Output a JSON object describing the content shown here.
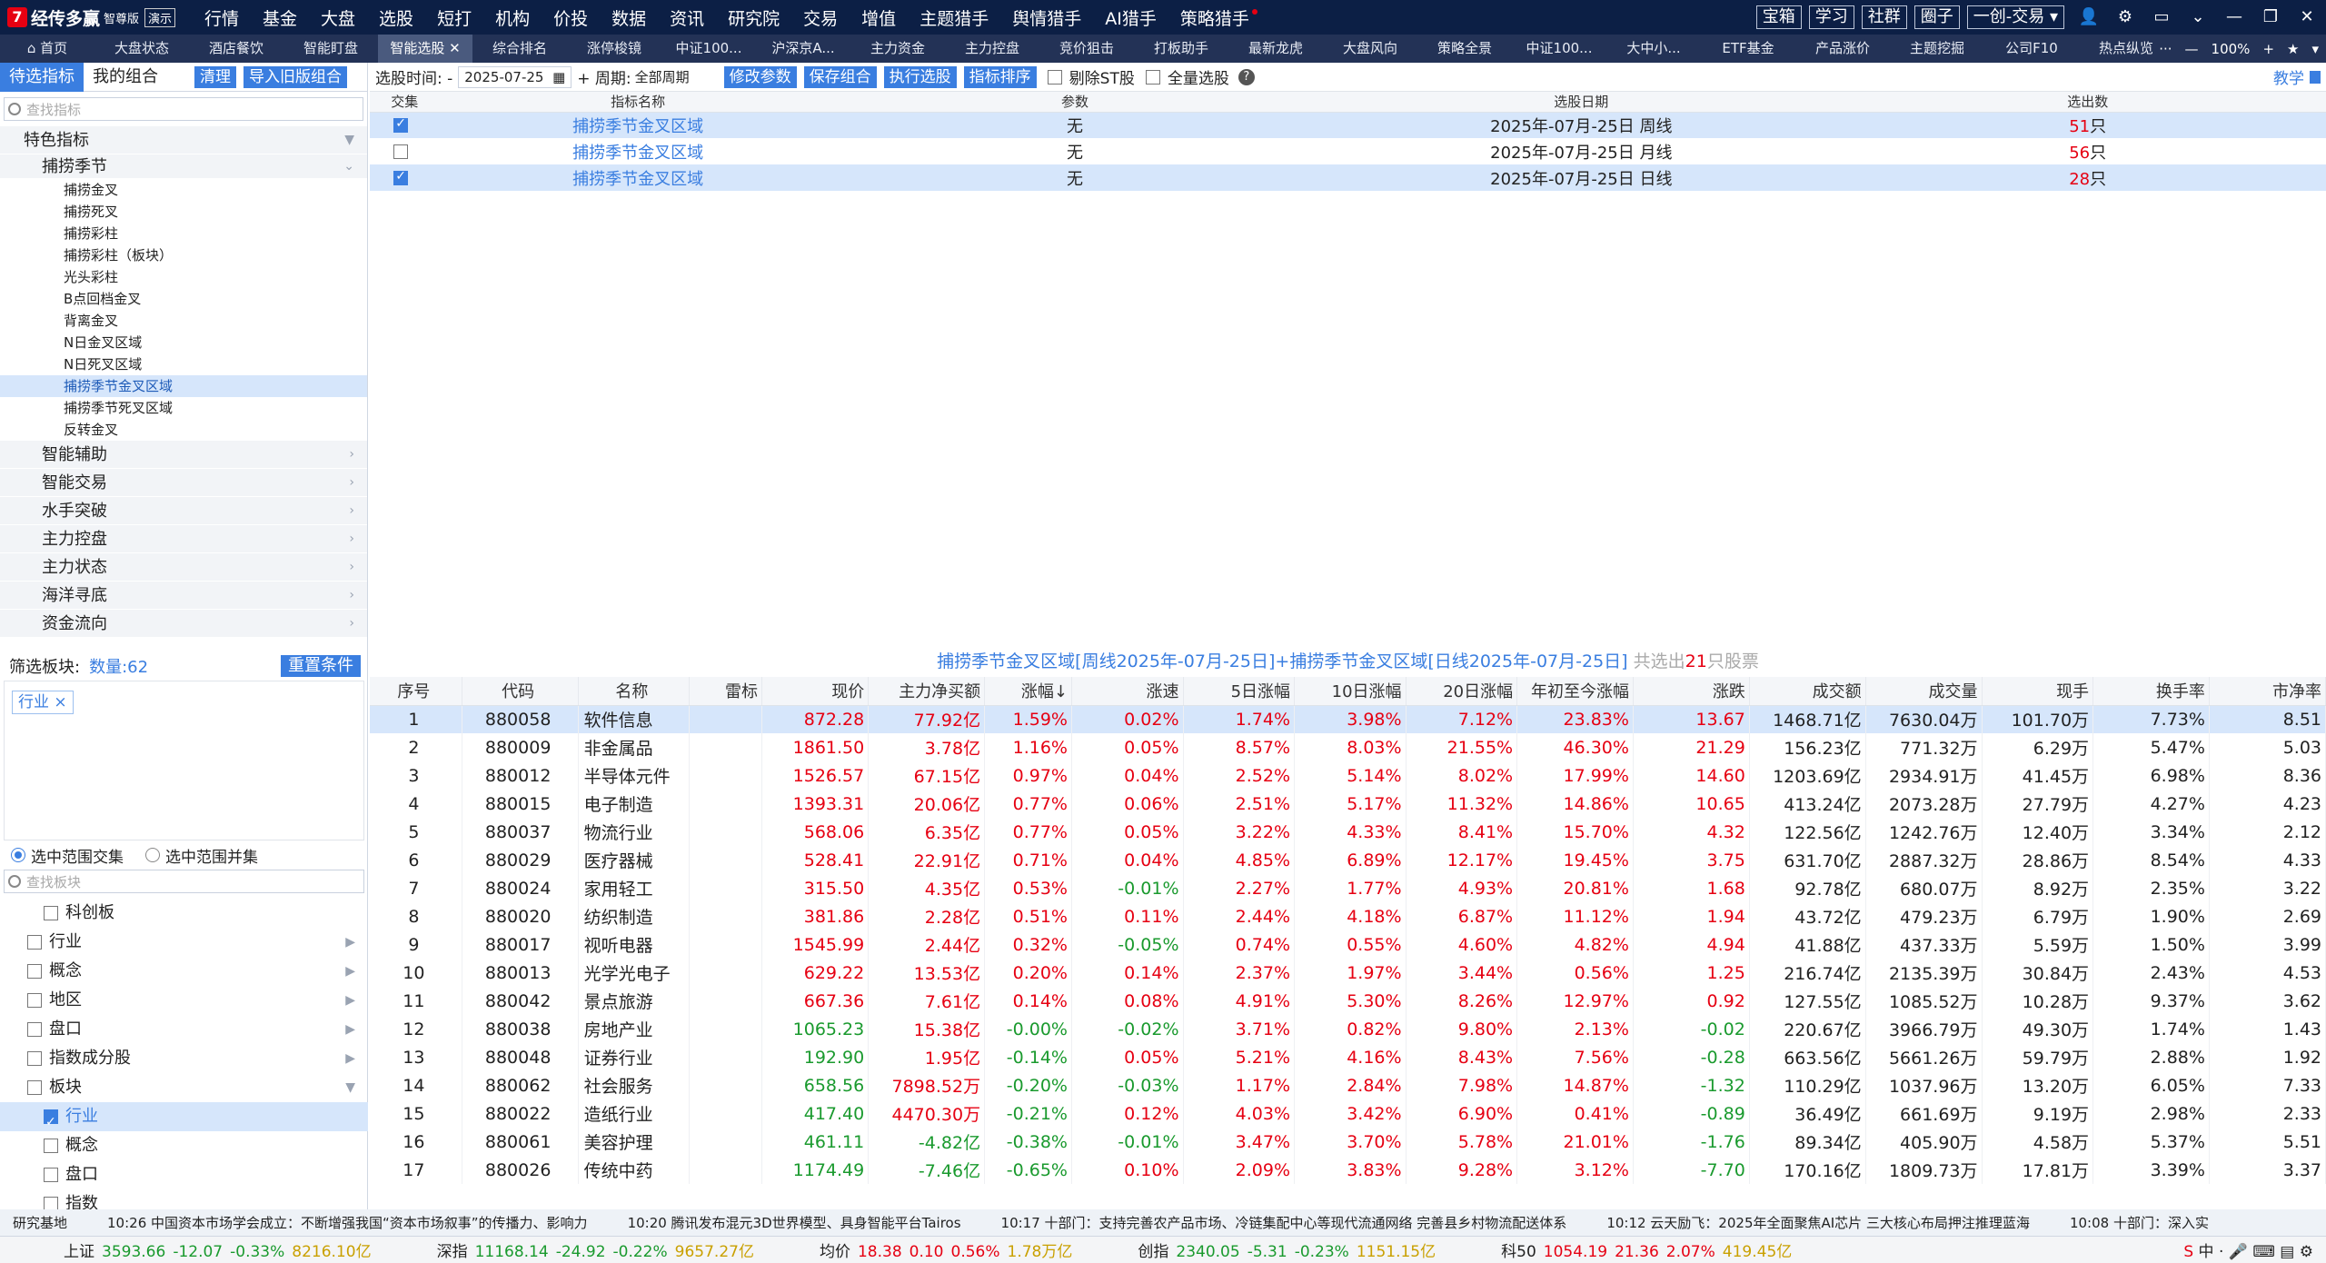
{
  "app": {
    "name": "经传多赢",
    "edition": "智尊版",
    "mode": "演示"
  },
  "menu": [
    "行情",
    "基金",
    "大盘",
    "选股",
    "短打",
    "机构",
    "价投",
    "数据",
    "资讯",
    "研究院",
    "交易",
    "增值",
    "主题猎手",
    "舆情猎手",
    "AI猎手",
    "策略猎手"
  ],
  "top_buttons": [
    "宝箱",
    "学习",
    "社群",
    "圈子",
    "一创-交易"
  ],
  "tabs": [
    "首页",
    "大盘状态",
    "酒店餐饮",
    "智能盯盘",
    "智能选股",
    "综合排名",
    "涨停梭镜",
    "中证100...",
    "沪深京A...",
    "主力资金",
    "主力控盘",
    "竞价狙击",
    "打板助手",
    "最新龙虎",
    "大盘风向",
    "策略全景",
    "中证100...",
    "大中小...",
    "ETF基金",
    "产品涨价",
    "主题挖掘",
    "公司F10",
    "热点纵览"
  ],
  "active_tab": "智能选股",
  "zoom": "100%",
  "left": {
    "tabs": [
      "待选指标",
      "我的组合"
    ],
    "buttons": [
      "清理",
      "导入旧版组合"
    ],
    "search_placeholder": "查找指标",
    "root": "特色指标",
    "group": "捕捞季节",
    "leaves": [
      "捕捞金叉",
      "捕捞死叉",
      "捕捞彩柱",
      "捕捞彩柱（板块）",
      "光头彩柱",
      "B点回档金叉",
      "背离金叉",
      "N日金叉区域",
      "N日死叉区域",
      "捕捞季节金叉区域",
      "捕捞季节死叉区域",
      "反转金叉"
    ],
    "selected_leaf": "捕捞季节金叉区域",
    "groups": [
      "智能辅助",
      "智能交易",
      "水手突破",
      "主力控盘",
      "主力状态",
      "海洋寻底",
      "资金流向"
    ],
    "filter_label": "筛选板块:",
    "count_label": "数量:62",
    "reset": "重置条件",
    "tag": "行业",
    "radio": [
      "选中范围交集",
      "选中范围并集"
    ],
    "search_board": "查找板块",
    "board_items": [
      {
        "label": "科创板",
        "indent": true,
        "checked": false,
        "arrow": ""
      },
      {
        "label": "行业",
        "indent": false,
        "checked": false,
        "arrow": "▶"
      },
      {
        "label": "概念",
        "indent": false,
        "checked": false,
        "arrow": "▶"
      },
      {
        "label": "地区",
        "indent": false,
        "checked": false,
        "arrow": "▶"
      },
      {
        "label": "盘口",
        "indent": false,
        "checked": false,
        "arrow": "▶"
      },
      {
        "label": "指数成分股",
        "indent": false,
        "checked": false,
        "arrow": "▶"
      },
      {
        "label": "板块",
        "indent": false,
        "checked": false,
        "arrow": "▼"
      },
      {
        "label": "行业",
        "indent": true,
        "checked": true,
        "arrow": ""
      },
      {
        "label": "概念",
        "indent": true,
        "checked": false,
        "arrow": ""
      },
      {
        "label": "盘口",
        "indent": true,
        "checked": false,
        "arrow": ""
      },
      {
        "label": "指数",
        "indent": true,
        "checked": false,
        "arrow": ""
      }
    ]
  },
  "toolbar": {
    "date_label": "选股时间: -",
    "date": "2025-07-25",
    "period_label": "+ 周期:",
    "period": "全部周期",
    "buttons": [
      "修改参数",
      "保存组合",
      "执行选股",
      "指标排序"
    ],
    "checks": [
      "剔除ST股",
      "全量选股"
    ],
    "help": "教学"
  },
  "top_table": {
    "headers": [
      "交集",
      "指标名称",
      "参数",
      "选股日期",
      "选出数"
    ],
    "rows": [
      {
        "checked": true,
        "name": "捕捞季节金叉区域",
        "param": "无",
        "date": "2025年-07月-25日 周线",
        "num": "51",
        "unit": "只"
      },
      {
        "checked": false,
        "name": "捕捞季节金叉区域",
        "param": "无",
        "date": "2025年-07月-25日 月线",
        "num": "56",
        "unit": "只"
      },
      {
        "checked": true,
        "name": "捕捞季节金叉区域",
        "param": "无",
        "date": "2025年-07月-25日 日线",
        "num": "28",
        "unit": "只"
      }
    ]
  },
  "result_title": {
    "text": "捕捞季节金叉区域[周线2025年-07月-25日]+捕捞季节金叉区域[日线2025年-07月-25日]",
    "prefix": "共选出",
    "count": "21",
    "suffix": "只股票"
  },
  "bottom_table": {
    "headers": [
      "序号",
      "代码",
      "名称",
      "雷标",
      "现价",
      "主力净买额",
      "涨幅↓",
      "涨速",
      "5日涨幅",
      "10日涨幅",
      "20日涨幅",
      "年初至今涨幅",
      "涨跌",
      "成交额",
      "成交量",
      "现手",
      "换手率",
      "市净率"
    ],
    "rows": [
      [
        "1",
        "880058",
        "软件信息",
        "",
        "872.28",
        "77.92亿",
        "1.59%",
        "0.02%",
        "1.74%",
        "3.98%",
        "7.12%",
        "23.83%",
        "13.67",
        "1468.71亿",
        "7630.04万",
        "101.70万",
        "7.73%",
        "8.51"
      ],
      [
        "2",
        "880009",
        "非金属品",
        "",
        "1861.50",
        "3.78亿",
        "1.16%",
        "0.05%",
        "8.57%",
        "8.03%",
        "21.55%",
        "46.30%",
        "21.29",
        "156.23亿",
        "771.32万",
        "6.29万",
        "5.47%",
        "5.03"
      ],
      [
        "3",
        "880012",
        "半导体元件",
        "",
        "1526.57",
        "67.15亿",
        "0.97%",
        "0.04%",
        "2.52%",
        "5.14%",
        "8.02%",
        "17.99%",
        "14.60",
        "1203.69亿",
        "2934.91万",
        "41.45万",
        "6.98%",
        "8.36"
      ],
      [
        "4",
        "880015",
        "电子制造",
        "",
        "1393.31",
        "20.06亿",
        "0.77%",
        "0.06%",
        "2.51%",
        "5.17%",
        "11.32%",
        "14.86%",
        "10.65",
        "413.24亿",
        "2073.28万",
        "27.79万",
        "4.27%",
        "4.23"
      ],
      [
        "5",
        "880037",
        "物流行业",
        "",
        "568.06",
        "6.35亿",
        "0.77%",
        "0.05%",
        "3.22%",
        "4.33%",
        "8.41%",
        "15.70%",
        "4.32",
        "122.56亿",
        "1242.76万",
        "12.40万",
        "3.34%",
        "2.12"
      ],
      [
        "6",
        "880029",
        "医疗器械",
        "",
        "528.41",
        "22.91亿",
        "0.71%",
        "0.04%",
        "4.85%",
        "6.89%",
        "12.17%",
        "19.45%",
        "3.75",
        "631.70亿",
        "2887.32万",
        "28.86万",
        "8.54%",
        "4.33"
      ],
      [
        "7",
        "880024",
        "家用轻工",
        "",
        "315.50",
        "4.35亿",
        "0.53%",
        "-0.01%",
        "2.27%",
        "1.77%",
        "4.93%",
        "20.81%",
        "1.68",
        "92.78亿",
        "680.07万",
        "8.92万",
        "2.35%",
        "3.22"
      ],
      [
        "8",
        "880020",
        "纺织制造",
        "",
        "381.86",
        "2.28亿",
        "0.51%",
        "0.11%",
        "2.44%",
        "4.18%",
        "6.87%",
        "11.12%",
        "1.94",
        "43.72亿",
        "479.23万",
        "6.79万",
        "1.90%",
        "2.69"
      ],
      [
        "9",
        "880017",
        "视听电器",
        "",
        "1545.99",
        "2.44亿",
        "0.32%",
        "-0.05%",
        "0.74%",
        "0.55%",
        "4.60%",
        "4.82%",
        "4.94",
        "41.88亿",
        "437.33万",
        "5.59万",
        "1.50%",
        "3.99"
      ],
      [
        "10",
        "880013",
        "光学光电子",
        "",
        "629.22",
        "13.53亿",
        "0.20%",
        "0.14%",
        "2.37%",
        "1.97%",
        "3.44%",
        "0.56%",
        "1.25",
        "216.74亿",
        "2135.39万",
        "30.84万",
        "2.43%",
        "4.53"
      ],
      [
        "11",
        "880042",
        "景点旅游",
        "",
        "667.36",
        "7.61亿",
        "0.14%",
        "0.08%",
        "4.91%",
        "5.30%",
        "8.26%",
        "12.97%",
        "0.92",
        "127.55亿",
        "1085.52万",
        "10.28万",
        "9.37%",
        "3.62"
      ],
      [
        "12",
        "880038",
        "房地产业",
        "",
        "1065.23",
        "15.38亿",
        "-0.00%",
        "-0.02%",
        "3.71%",
        "0.82%",
        "9.80%",
        "2.13%",
        "-0.02",
        "220.67亿",
        "3966.79万",
        "49.30万",
        "1.74%",
        "1.43"
      ],
      [
        "13",
        "880048",
        "证券行业",
        "",
        "192.90",
        "1.95亿",
        "-0.14%",
        "0.05%",
        "5.21%",
        "4.16%",
        "8.43%",
        "7.56%",
        "-0.28",
        "663.56亿",
        "5661.26万",
        "59.79万",
        "2.88%",
        "1.92"
      ],
      [
        "14",
        "880062",
        "社会服务",
        "",
        "658.56",
        "7898.52万",
        "-0.20%",
        "-0.03%",
        "1.17%",
        "2.84%",
        "7.98%",
        "14.87%",
        "-1.32",
        "110.29亿",
        "1037.96万",
        "13.20万",
        "6.05%",
        "7.33"
      ],
      [
        "15",
        "880022",
        "造纸行业",
        "",
        "417.40",
        "4470.30万",
        "-0.21%",
        "0.12%",
        "4.03%",
        "3.42%",
        "6.90%",
        "0.41%",
        "-0.89",
        "36.49亿",
        "661.69万",
        "9.19万",
        "2.98%",
        "2.33"
      ],
      [
        "16",
        "880061",
        "美容护理",
        "",
        "461.11",
        "-4.82亿",
        "-0.38%",
        "-0.01%",
        "3.47%",
        "3.70%",
        "5.78%",
        "21.01%",
        "-1.76",
        "89.34亿",
        "405.90万",
        "4.58万",
        "5.37%",
        "5.51"
      ],
      [
        "17",
        "880026",
        "传统中药",
        "",
        "1174.49",
        "-7.46亿",
        "-0.65%",
        "0.10%",
        "2.09%",
        "3.83%",
        "9.28%",
        "3.12%",
        "-7.70",
        "170.16亿",
        "1809.73万",
        "17.81万",
        "3.39%",
        "3.37"
      ]
    ]
  },
  "news": [
    "研究基地",
    "10:26 中国资本市场学会成立：不断增强我国“资本市场叙事”的传播力、影响力",
    "10:20 腾讯发布混元3D世界模型、具身智能平台Tairos",
    "10:17 十部门：支持完善农产品市场、冷链集配中心等现代流通网络 完善县乡村物流配送体系",
    "10:12 云天励飞：2025年全面聚焦AI芯片 三大核心布局押注推理蓝海",
    "10:08 十部门：深入实"
  ],
  "status": [
    {
      "name": "上证",
      "v": "3593.66",
      "c": "-12.07",
      "p": "-0.33%",
      "a": "8216.10亿"
    },
    {
      "name": "深指",
      "v": "11168.14",
      "c": "-24.92",
      "p": "-0.22%",
      "a": "9657.27亿"
    },
    {
      "name": "均价",
      "v": "18.38",
      "c": "0.10",
      "p": "0.56%",
      "a": "1.78万亿"
    },
    {
      "name": "创指",
      "v": "2340.05",
      "c": "-5.31",
      "p": "-0.23%",
      "a": "1151.15亿"
    },
    {
      "name": "科50",
      "v": "1054.19",
      "c": "21.36",
      "p": "2.07%",
      "a": "419.45亿"
    }
  ]
}
